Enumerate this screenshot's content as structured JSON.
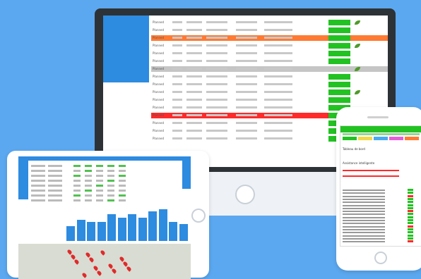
{
  "colors": {
    "background": "#5ba8f0",
    "accent": "#2d8be0",
    "ok": "#22c222",
    "warning": "#ff7a33",
    "danger": "#ff2a2a"
  },
  "monitor": {
    "rows": [
      {
        "label": "Planned",
        "status": "ok"
      },
      {
        "label": "Planned",
        "status": "ok"
      },
      {
        "label": "Planned",
        "status": "warning"
      },
      {
        "label": "Planned",
        "status": "ok"
      },
      {
        "label": "Planned",
        "status": "ok"
      },
      {
        "label": "Planned",
        "status": "ok"
      },
      {
        "label": "Planned",
        "status": "neutral"
      },
      {
        "label": "Planned",
        "status": "ok"
      },
      {
        "label": "Planned",
        "status": "ok"
      },
      {
        "label": "Planned",
        "status": "ok"
      },
      {
        "label": "Planned",
        "status": "ok"
      },
      {
        "label": "Planned",
        "status": "ok"
      },
      {
        "label": "Planned",
        "status": "danger"
      },
      {
        "label": "Planned",
        "status": "ok"
      },
      {
        "label": "Planned",
        "status": "ok"
      },
      {
        "label": "Planned",
        "status": "ok"
      }
    ]
  },
  "tablet": {
    "chart": {
      "type": "bar",
      "values": [
        14,
        20,
        18,
        18,
        25,
        22,
        25,
        22,
        28,
        30,
        18,
        16
      ]
    },
    "map": {
      "marker_count": 14
    }
  },
  "phone": {
    "header": "Tableau de bord",
    "subheader": "Assistance intelligente"
  }
}
